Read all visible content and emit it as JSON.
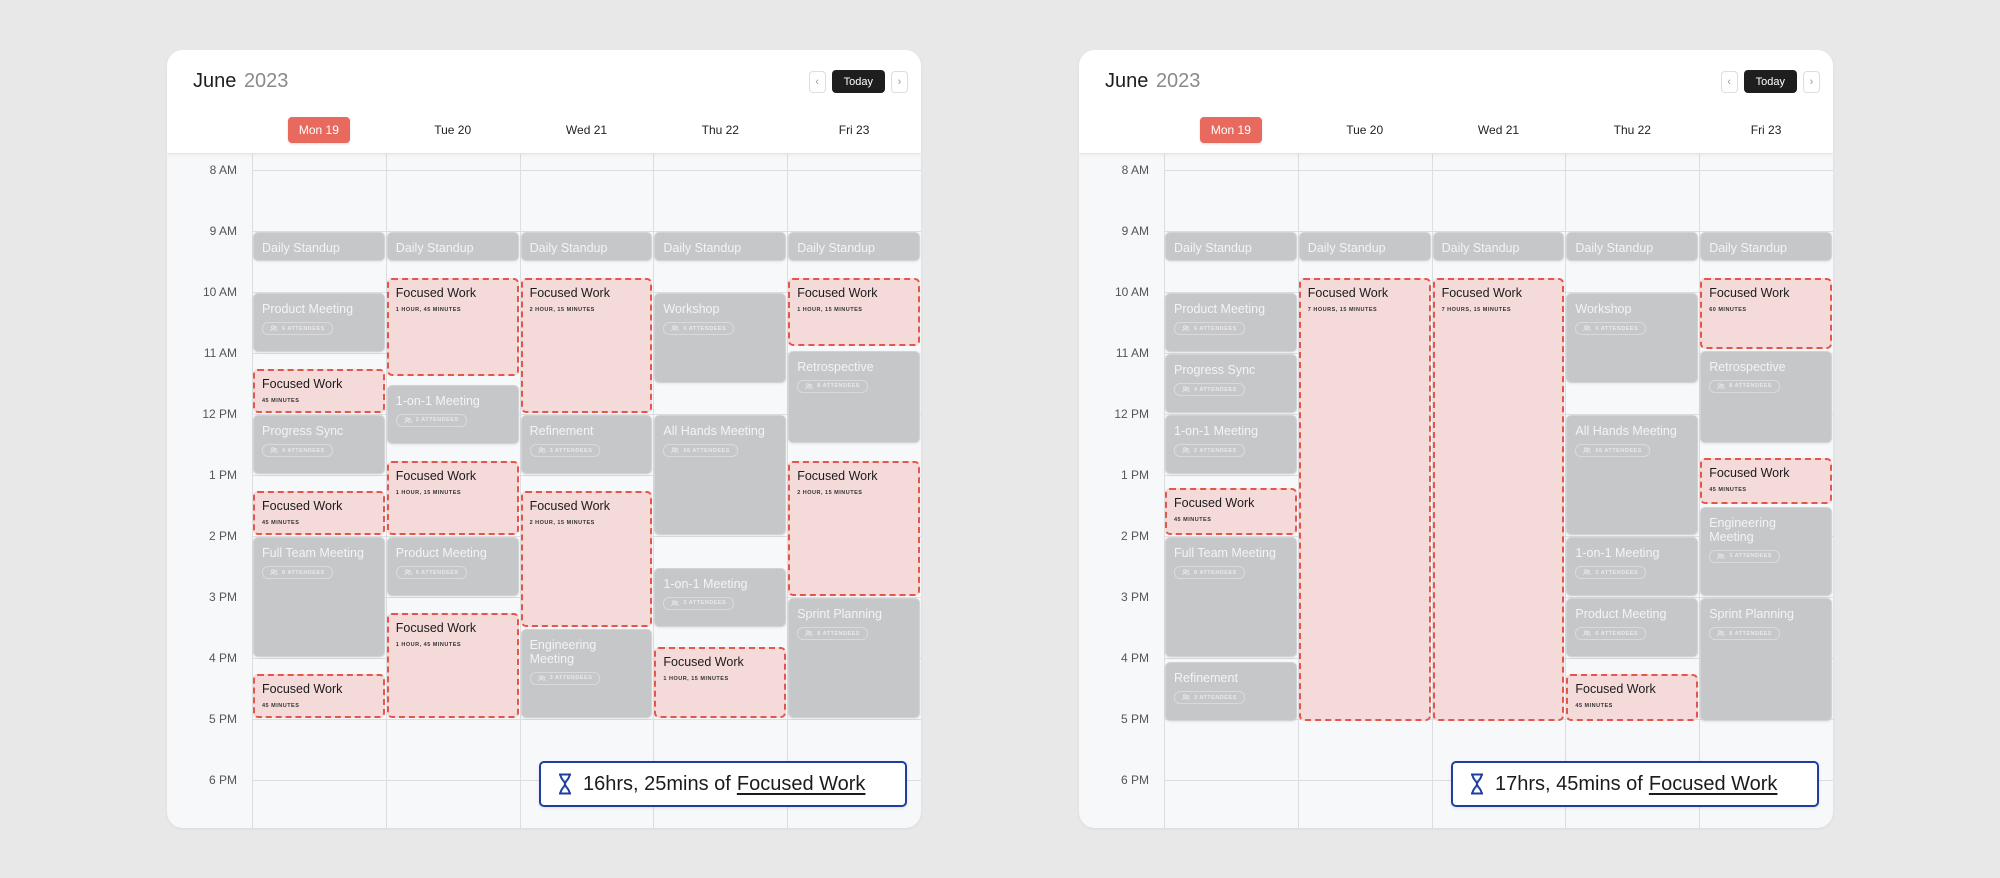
{
  "calendars": [
    {
      "id": "left",
      "month": "June",
      "year": "2023",
      "today_label": "Today",
      "summary": {
        "value": "16hrs, 25mins of",
        "link": "Focused Work"
      },
      "days": [
        {
          "label": "Mon 19",
          "today": true
        },
        {
          "label": "Tue 20",
          "today": false
        },
        {
          "label": "Wed 21",
          "today": false
        },
        {
          "label": "Thu 22",
          "today": false
        },
        {
          "label": "Fri 23",
          "today": false
        }
      ],
      "hours": [
        "8 AM",
        "9 AM",
        "10 AM",
        "11 AM",
        "12 PM",
        "1 PM",
        "2 PM",
        "3 PM",
        "4 PM",
        "5 PM",
        "6 PM"
      ],
      "events": [
        {
          "day": 0,
          "type": "meeting",
          "title": "Daily Standup",
          "start": 9,
          "end": 9.5
        },
        {
          "day": 1,
          "type": "meeting",
          "title": "Daily Standup",
          "start": 9,
          "end": 9.5
        },
        {
          "day": 2,
          "type": "meeting",
          "title": "Daily Standup",
          "start": 9,
          "end": 9.5
        },
        {
          "day": 3,
          "type": "meeting",
          "title": "Daily Standup",
          "start": 9,
          "end": 9.5
        },
        {
          "day": 4,
          "type": "meeting",
          "title": "Daily Standup",
          "start": 9,
          "end": 9.5
        },
        {
          "day": 0,
          "type": "meeting",
          "title": "Product Meeting",
          "attendees": "6 Attendees",
          "start": 10,
          "end": 11
        },
        {
          "day": 0,
          "type": "focus",
          "title": "Focused Work",
          "duration": "45 Minutes",
          "start": 11.25,
          "end": 12
        },
        {
          "day": 0,
          "type": "meeting",
          "title": "Progress Sync",
          "attendees": "4 Attendees",
          "start": 12,
          "end": 13
        },
        {
          "day": 0,
          "type": "focus",
          "title": "Focused Work",
          "duration": "45 Minutes",
          "start": 13.25,
          "end": 14
        },
        {
          "day": 0,
          "type": "meeting",
          "title": "Full Team Meeting",
          "attendees": "8 Attendees",
          "start": 14,
          "end": 16
        },
        {
          "day": 0,
          "type": "focus",
          "title": "Focused Work",
          "duration": "45 Minutes",
          "start": 16.25,
          "end": 17
        },
        {
          "day": 1,
          "type": "focus",
          "title": "Focused Work",
          "duration": "1 Hour, 45 Minutes",
          "start": 9.75,
          "end": 11.4
        },
        {
          "day": 1,
          "type": "meeting",
          "title": "1-on-1 Meeting",
          "attendees": "2 Attendees",
          "start": 11.5,
          "end": 12.5
        },
        {
          "day": 1,
          "type": "focus",
          "title": "Focused Work",
          "duration": "1 Hour, 15 Minutes",
          "start": 12.75,
          "end": 14
        },
        {
          "day": 1,
          "type": "meeting",
          "title": "Product Meeting",
          "attendees": "6 Attendees",
          "start": 14,
          "end": 15
        },
        {
          "day": 1,
          "type": "focus",
          "title": "Focused Work",
          "duration": "1 Hour, 45 Minutes",
          "start": 15.25,
          "end": 17
        },
        {
          "day": 2,
          "type": "focus",
          "title": "Focused Work",
          "duration": "2 Hour, 15 Minutes",
          "start": 9.75,
          "end": 12
        },
        {
          "day": 2,
          "type": "meeting",
          "title": "Refinement",
          "attendees": "3 Attendees",
          "start": 12,
          "end": 13
        },
        {
          "day": 2,
          "type": "focus",
          "title": "Focused Work",
          "duration": "2 Hour, 15 Minutes",
          "start": 13.25,
          "end": 15.5
        },
        {
          "day": 2,
          "type": "meeting",
          "title": "Engineering Meeting",
          "attendees": "3 Attendees",
          "start": 15.5,
          "end": 17
        },
        {
          "day": 3,
          "type": "meeting",
          "title": "Workshop",
          "attendees": "6 Attendees",
          "start": 10,
          "end": 11.5
        },
        {
          "day": 3,
          "type": "meeting",
          "title": "All Hands Meeting",
          "attendees": "56 Attendees",
          "start": 12,
          "end": 14
        },
        {
          "day": 3,
          "type": "meeting",
          "title": "1-on-1 Meeting",
          "attendees": "2 Attendees",
          "start": 14.5,
          "end": 15.5
        },
        {
          "day": 3,
          "type": "focus",
          "title": "Focused Work",
          "duration": "1 Hour, 15 Minutes",
          "start": 15.8,
          "end": 17
        },
        {
          "day": 4,
          "type": "focus",
          "title": "Focused Work",
          "duration": "1 Hour, 15 Minutes",
          "start": 9.75,
          "end": 10.9
        },
        {
          "day": 4,
          "type": "meeting",
          "title": "Retrospective",
          "attendees": "8 Attendees",
          "start": 10.95,
          "end": 12.5
        },
        {
          "day": 4,
          "type": "focus",
          "title": "Focused Work",
          "duration": "2 Hour, 15 Minutes",
          "start": 12.75,
          "end": 15
        },
        {
          "day": 4,
          "type": "meeting",
          "title": "Sprint Planning",
          "attendees": "8 Attendees",
          "start": 15,
          "end": 17
        }
      ]
    },
    {
      "id": "right",
      "month": "June",
      "year": "2023",
      "today_label": "Today",
      "summary": {
        "value": "17hrs, 45mins of",
        "link": "Focused Work"
      },
      "days": [
        {
          "label": "Mon 19",
          "today": true
        },
        {
          "label": "Tue 20",
          "today": false
        },
        {
          "label": "Wed 21",
          "today": false
        },
        {
          "label": "Thu 22",
          "today": false
        },
        {
          "label": "Fri 23",
          "today": false
        }
      ],
      "hours": [
        "8 AM",
        "9 AM",
        "10 AM",
        "11 AM",
        "12 PM",
        "1 PM",
        "2 PM",
        "3 PM",
        "4 PM",
        "5 PM",
        "6 PM"
      ],
      "events": [
        {
          "day": 0,
          "type": "meeting",
          "title": "Daily Standup",
          "start": 9,
          "end": 9.5
        },
        {
          "day": 1,
          "type": "meeting",
          "title": "Daily Standup",
          "start": 9,
          "end": 9.5
        },
        {
          "day": 2,
          "type": "meeting",
          "title": "Daily Standup",
          "start": 9,
          "end": 9.5
        },
        {
          "day": 3,
          "type": "meeting",
          "title": "Daily Standup",
          "start": 9,
          "end": 9.5
        },
        {
          "day": 4,
          "type": "meeting",
          "title": "Daily Standup",
          "start": 9,
          "end": 9.5
        },
        {
          "day": 0,
          "type": "meeting",
          "title": "Product Meeting",
          "attendees": "6 Attendees",
          "start": 10,
          "end": 11
        },
        {
          "day": 0,
          "type": "meeting",
          "title": "Progress Sync",
          "attendees": "4 Attendees",
          "start": 11,
          "end": 12
        },
        {
          "day": 0,
          "type": "meeting",
          "title": "1-on-1 Meeting",
          "attendees": "2 Attendees",
          "start": 12,
          "end": 13
        },
        {
          "day": 0,
          "type": "focus",
          "title": "Focused Work",
          "duration": "45 Minutes",
          "start": 13.2,
          "end": 14
        },
        {
          "day": 0,
          "type": "meeting",
          "title": "Full Team Meeting",
          "attendees": "8 Attendees",
          "start": 14,
          "end": 16
        },
        {
          "day": 0,
          "type": "meeting",
          "title": "Refinement",
          "attendees": "3 Attendees",
          "start": 16.05,
          "end": 17.05
        },
        {
          "day": 1,
          "type": "focus",
          "title": "Focused Work",
          "duration": "7 Hours, 15 Minutes",
          "start": 9.75,
          "end": 17.05
        },
        {
          "day": 2,
          "type": "focus",
          "title": "Focused Work",
          "duration": "7 Hours, 15 Minutes",
          "start": 9.75,
          "end": 17.05
        },
        {
          "day": 3,
          "type": "meeting",
          "title": "Workshop",
          "attendees": "6 Attendees",
          "start": 10,
          "end": 11.5
        },
        {
          "day": 3,
          "type": "meeting",
          "title": "All Hands Meeting",
          "attendees": "56 Attendees",
          "start": 12,
          "end": 14
        },
        {
          "day": 3,
          "type": "meeting",
          "title": "1-on-1 Meeting",
          "attendees": "2 Attendees",
          "start": 14,
          "end": 15
        },
        {
          "day": 3,
          "type": "meeting",
          "title": "Product Meeting",
          "attendees": "6 Attendees",
          "start": 15,
          "end": 16
        },
        {
          "day": 3,
          "type": "focus",
          "title": "Focused Work",
          "duration": "45 Minutes",
          "start": 16.25,
          "end": 17.05
        },
        {
          "day": 4,
          "type": "focus",
          "title": "Focused Work",
          "duration": "60 Minutes",
          "start": 9.75,
          "end": 10.95
        },
        {
          "day": 4,
          "type": "meeting",
          "title": "Retrospective",
          "attendees": "8 Attendees",
          "start": 10.95,
          "end": 12.5
        },
        {
          "day": 4,
          "type": "focus",
          "title": "Focused Work",
          "duration": "45 Minutes",
          "start": 12.7,
          "end": 13.5
        },
        {
          "day": 4,
          "type": "meeting",
          "title": "Engineering Meeting",
          "attendees": "3 Attendees",
          "start": 13.5,
          "end": 15
        },
        {
          "day": 4,
          "type": "meeting",
          "title": "Sprint Planning",
          "attendees": "8 Attendees",
          "start": 15,
          "end": 17.05
        }
      ]
    }
  ]
}
